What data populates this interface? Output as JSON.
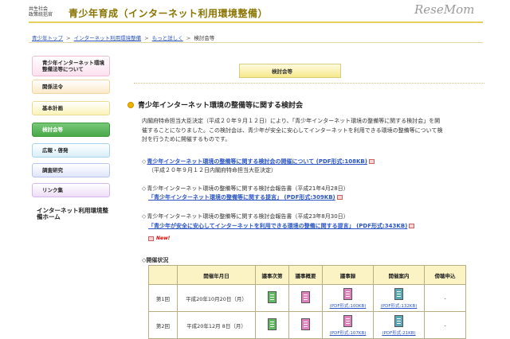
{
  "header": {
    "org_line1": "共生社会",
    "org_line2": "政策統括官",
    "title": "青少年育成（インターネット利用環境整備）",
    "watermark": "ReseMom"
  },
  "breadcrumb": {
    "items": [
      "青少年トップ",
      "インターネット利用環境整備",
      "もっと詳しく"
    ],
    "current": "検討会等",
    "separator": ">"
  },
  "sidebar": {
    "items": [
      {
        "label": "青少年インターネット環境整備法等について"
      },
      {
        "label": "関係法令"
      },
      {
        "label": "基本計画"
      },
      {
        "label": "検討会等"
      },
      {
        "label": "広報・啓発"
      },
      {
        "label": "調査研究"
      },
      {
        "label": "リンク集"
      },
      {
        "label": "インターネット利用環境整備ホーム"
      }
    ]
  },
  "section_tab": "検討会等",
  "main": {
    "heading": "青少年インターネット環境の整備等に関する検討会",
    "intro": "内閣府特命担当大臣決定（平成２０年９月１２日）により、「青少年インターネット環境の整備等に関する検討会」を開催することになりました。この検討会は、青少年が安全に安心してインターネットを利用できる環境の整備等について検討を行うために開催するものです。",
    "entries": [
      {
        "link": "青少年インターネット環境の整備等に関する検討会の開催について (PDF形式:108KB)",
        "note": "（平成２０年９月１２日内閣府特命担当大臣決定）"
      },
      {
        "title": "青少年インターネット環境の整備等に関する検討会報告書（平成21年4月28日）",
        "link": "「青少年インターネット環境の整備等に関する提言」 (PDF形式:309KB)"
      },
      {
        "title": "青少年インターネット環境の整備等に関する検討会報告書（平成23年8月30日）",
        "link": "「青少年が安全に安心してインターネットを利用できる環境の整備に関する提言」 (PDF形式:343KB)"
      }
    ],
    "new_label": "New!",
    "status_heading": "開催状況"
  },
  "table": {
    "headers": [
      "",
      "開催年月日",
      "議事次第",
      "議事概要",
      "議事録",
      "開催案内",
      "傍聴申込"
    ],
    "rows": [
      {
        "no": "第1回",
        "date": "平成20年10月20日（月）",
        "minutes_pdf": "(PDF形式:100KB)",
        "notice_pdf": "(PDF形式:132KB)",
        "apply": "-"
      },
      {
        "no": "第2回",
        "date": "平成20年12月 8日（月）",
        "minutes_pdf": "(PDF形式:107KB)",
        "notice_pdf": "(PDF形式:21KB)",
        "apply": "-"
      }
    ]
  },
  "colors": {
    "title": "#8a7400",
    "link": "#2b55c4",
    "active_nav": "#4aa84a",
    "table_header": "#fbf3c4"
  }
}
